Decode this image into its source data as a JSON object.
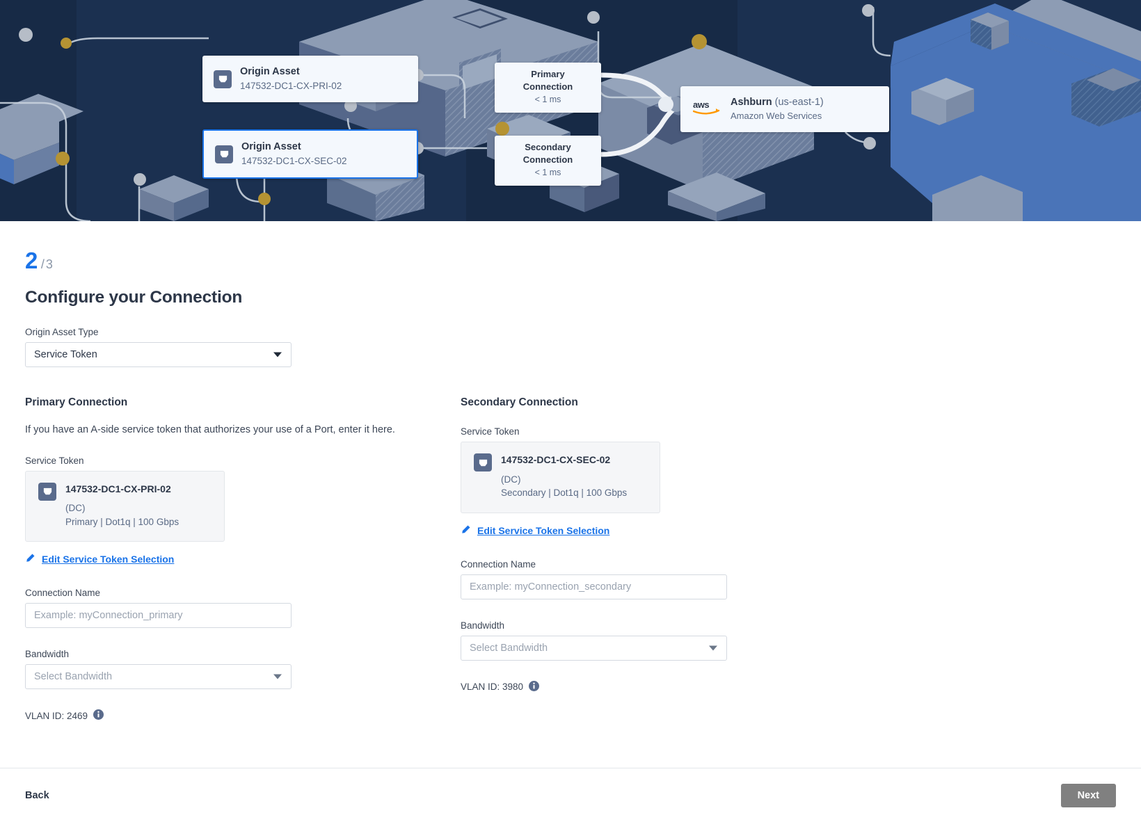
{
  "hero": {
    "origin_cards": [
      {
        "title": "Origin Asset",
        "subtitle": "147532-DC1-CX-PRI-02",
        "selected": false
      },
      {
        "title": "Origin Asset",
        "subtitle": "147532-DC1-CX-SEC-02",
        "selected": true
      }
    ],
    "connections": [
      {
        "title": "Primary Connection",
        "latency": "< 1 ms"
      },
      {
        "title": "Secondary Connection",
        "latency": "< 1 ms"
      }
    ],
    "destination": {
      "logo_text": "aws",
      "name": "Ashburn",
      "region": "(us-east-1)",
      "provider": "Amazon Web Services"
    }
  },
  "step": {
    "current": "2",
    "separator": "/",
    "total": "3"
  },
  "page_title": "Configure your Connection",
  "origin_asset_type": {
    "label": "Origin Asset Type",
    "value": "Service Token"
  },
  "primary": {
    "title": "Primary Connection",
    "description": "If you have an A-side service token that authorizes your use of a Port, enter it here.",
    "token_label": "Service Token",
    "token": {
      "name": "147532-DC1-CX-PRI-02",
      "dc": "(DC)",
      "meta": "Primary | Dot1q | 100 Gbps"
    },
    "edit_link": "Edit Service Token Selection",
    "connection_name_label": "Connection Name",
    "connection_name_value": "",
    "connection_name_placeholder": "Example: myConnection_primary",
    "bandwidth_label": "Bandwidth",
    "bandwidth_value": "Select Bandwidth",
    "vlan": "VLAN ID: 2469"
  },
  "secondary": {
    "title": "Secondary Connection",
    "description": "",
    "token_label": "Service Token",
    "token": {
      "name": "147532-DC1-CX-SEC-02",
      "dc": "(DC)",
      "meta": "Secondary | Dot1q | 100 Gbps"
    },
    "edit_link": "Edit Service Token Selection",
    "connection_name_label": "Connection Name",
    "connection_name_value": "",
    "connection_name_placeholder": "Example: myConnection_secondary",
    "bandwidth_label": "Bandwidth",
    "bandwidth_value": "Select Bandwidth",
    "vlan": "VLAN ID: 3980"
  },
  "footer": {
    "back": "Back",
    "next": "Next"
  },
  "colors": {
    "accent": "#1a73e8",
    "hero_bg": "#172a46",
    "card_bg": "#f4f8fd",
    "disabled_btn": "#808080",
    "aws_orange": "#ff9900",
    "icon_slate": "#5a6b8c",
    "gold_dot": "#b59333"
  }
}
